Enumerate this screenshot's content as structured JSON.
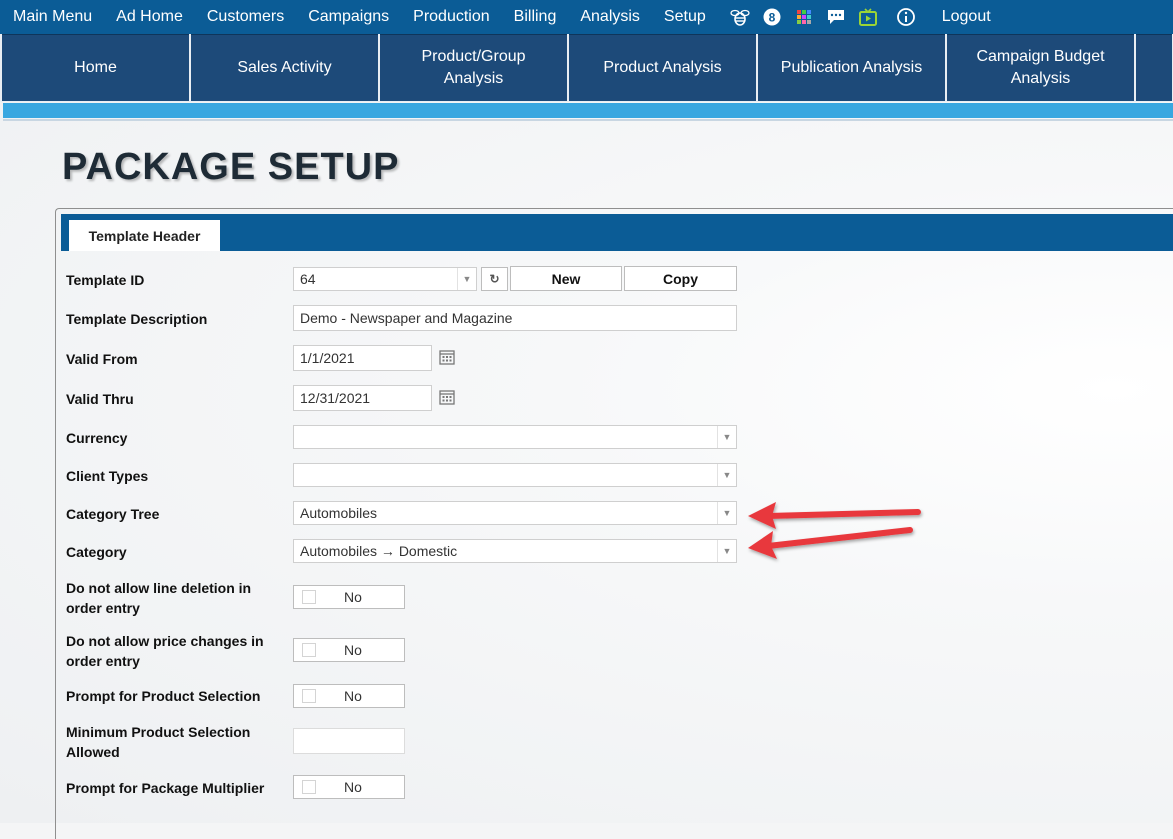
{
  "topmenu": {
    "items": [
      "Main Menu",
      "Ad Home",
      "Customers",
      "Campaigns",
      "Production",
      "Billing",
      "Analysis",
      "Setup"
    ],
    "icons": [
      "bee-icon",
      "notification-count-icon",
      "apps-grid-icon",
      "chat-icon",
      "tv-icon",
      "info-icon"
    ],
    "badge_count": "8",
    "logout": "Logout"
  },
  "navtiles": [
    "Home",
    "Sales Activity",
    "Product/Group Analysis",
    "Product Analysis",
    "Publication Analysis",
    "Campaign Budget Analysis"
  ],
  "page": {
    "title": "PACKAGE SETUP"
  },
  "tabs": {
    "active": "Template Header"
  },
  "form": {
    "template_id": {
      "label": "Template ID",
      "value": "64",
      "new_btn": "New",
      "copy_btn": "Copy"
    },
    "template_description": {
      "label": "Template Description",
      "value": "Demo - Newspaper and Magazine"
    },
    "valid_from": {
      "label": "Valid From",
      "value": "1/1/2021"
    },
    "valid_thru": {
      "label": "Valid Thru",
      "value": "12/31/2021"
    },
    "currency": {
      "label": "Currency",
      "value": ""
    },
    "client_types": {
      "label": "Client Types",
      "value": ""
    },
    "category_tree": {
      "label": "Category Tree",
      "value": "Automobiles"
    },
    "category": {
      "label": "Category",
      "value": "Automobiles → Domestic"
    },
    "no_line_deletion": {
      "label_line1": "Do not allow line deletion in",
      "label_line2": "order entry",
      "value": "No"
    },
    "no_price_changes": {
      "label_line1": "Do not allow price changes in",
      "label_line2": "order entry",
      "value": "No"
    },
    "prompt_product": {
      "label": "Prompt for Product Selection",
      "value": "No"
    },
    "min_product": {
      "label_line1": "Minimum Product Selection",
      "label_line2": "Allowed",
      "value": ""
    },
    "prompt_multiplier": {
      "label": "Prompt for Package Multiplier",
      "value": "No"
    }
  },
  "colors": {
    "topbar": "#0b5c96",
    "navtile": "#1d4a79",
    "strip": "#39a7e0",
    "annotation_arrow": "#e8393c"
  }
}
